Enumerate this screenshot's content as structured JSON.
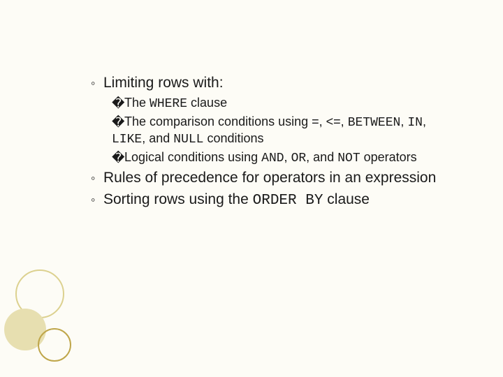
{
  "bullets": {
    "b1": {
      "leader": "Limiting rows with:",
      "sub": {
        "s1_pre": "The ",
        "s1_code": "WHERE",
        "s1_post": " clause",
        "s2_pre": "The comparison conditions using =, <=, ",
        "s2_code1": "BETWEEN",
        "s2_mid1": ", ",
        "s2_code2": "IN",
        "s2_mid2": ", ",
        "s2_code3": "LIKE",
        "s2_mid3": ", and ",
        "s2_code4": "NULL",
        "s2_post": " conditions",
        "s3_pre": "Logical conditions using ",
        "s3_code1": "AND",
        "s3_mid1": ", ",
        "s3_code2": "OR",
        "s3_mid2": ", and ",
        "s3_code3": "NOT",
        "s3_post": " operators"
      }
    },
    "b2": "Rules of precedence for operators in an expression",
    "b3_pre": "Sorting rows using the ",
    "b3_code": "ORDER BY",
    "b3_post": " clause"
  }
}
